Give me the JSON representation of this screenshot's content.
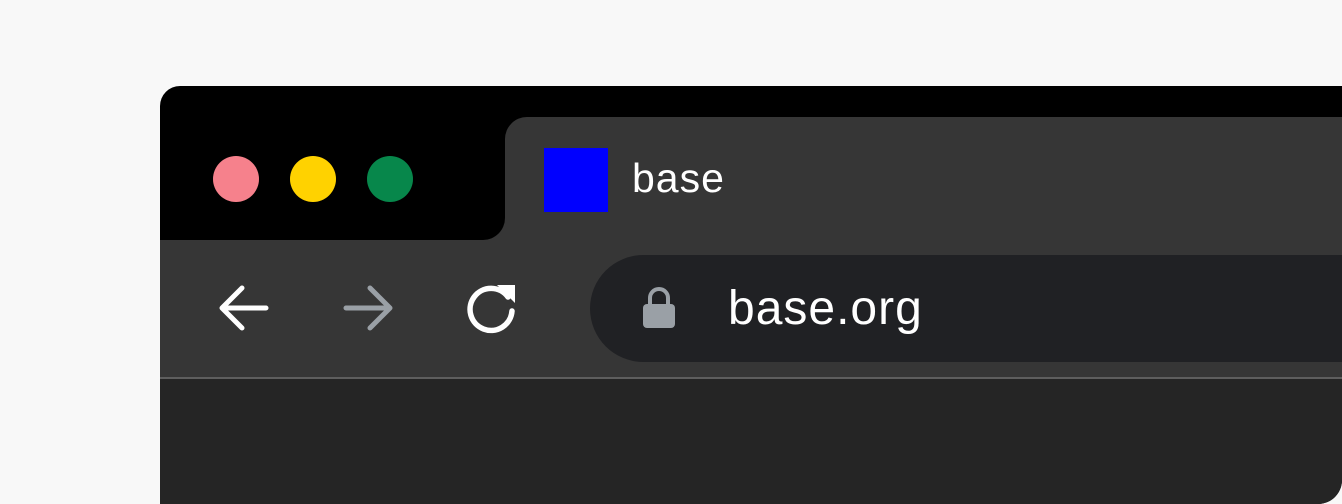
{
  "window_controls": {
    "close": {
      "icon": "close-dot-icon",
      "color": "#f6818c"
    },
    "minimize": {
      "icon": "minimize-dot-icon",
      "color": "#ffd200"
    },
    "maximize": {
      "icon": "maximize-dot-icon",
      "color": "#07874b"
    }
  },
  "tab": {
    "title": "base",
    "favicon": {
      "icon": "favicon-icon",
      "color": "#0000ff"
    }
  },
  "toolbar": {
    "back": {
      "icon": "arrow-left-icon",
      "color": "#ffffff",
      "enabled": true
    },
    "forward": {
      "icon": "arrow-right-icon",
      "color": "#9aa0a6",
      "enabled": false
    },
    "reload": {
      "icon": "reload-icon",
      "color": "#ffffff"
    }
  },
  "omnibox": {
    "lock_icon": "lock-icon",
    "lock_color": "#9aa0a6",
    "url": "base.org"
  }
}
